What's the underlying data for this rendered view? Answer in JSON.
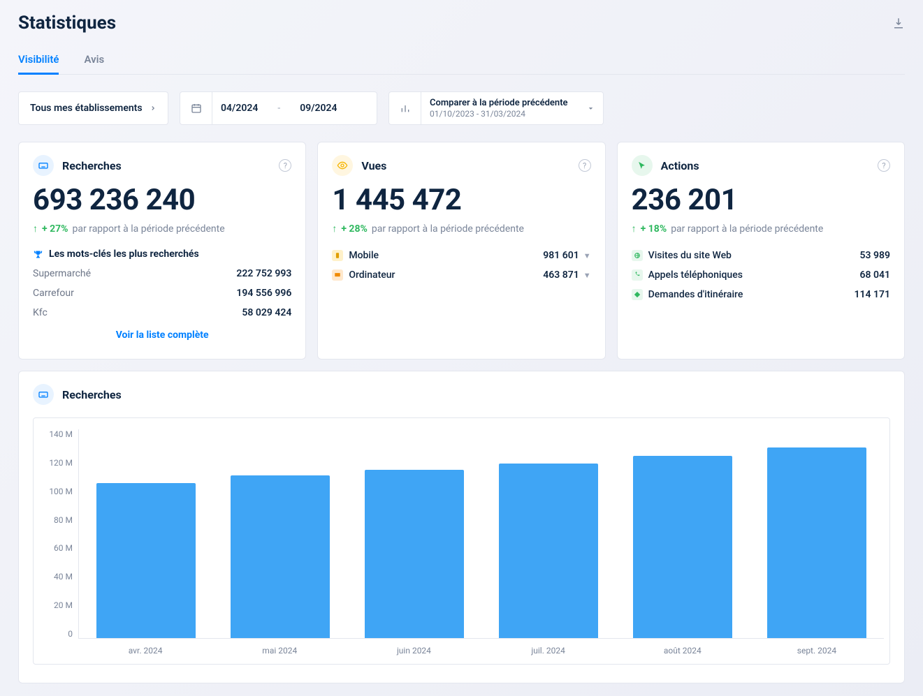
{
  "page_title": "Statistiques",
  "tabs": {
    "visibility": "Visibilité",
    "reviews": "Avis"
  },
  "filters": {
    "establishments": "Tous mes établissements",
    "date_from": "04/2024",
    "date_sep": "-",
    "date_to": "09/2024",
    "compare_title": "Comparer à la période précédente",
    "compare_sub": "01/10/2023 - 31/03/2024"
  },
  "cards": {
    "searches": {
      "title": "Recherches",
      "value": "693 236 240",
      "trend_pct": "+ 27%",
      "trend_text": "par rapport à la période précédente",
      "sub_title": "Les mots-clés les plus recherchés",
      "rows": [
        {
          "label": "Supermarché",
          "value": "222 752 993"
        },
        {
          "label": "Carrefour",
          "value": "194 556 996"
        },
        {
          "label": "Kfc",
          "value": "58 029 424"
        }
      ],
      "more_link": "Voir la liste complète"
    },
    "views": {
      "title": "Vues",
      "value": "1 445 472",
      "trend_pct": "+ 28%",
      "trend_text": "par rapport à la période précédente",
      "rows": [
        {
          "label": "Mobile",
          "value": "981 601"
        },
        {
          "label": "Ordinateur",
          "value": "463 871"
        }
      ]
    },
    "actions": {
      "title": "Actions",
      "value": "236 201",
      "trend_pct": "+ 18%",
      "trend_text": "par rapport à la période précédente",
      "rows": [
        {
          "label": "Visites du site Web",
          "value": "53 989"
        },
        {
          "label": "Appels téléphoniques",
          "value": "68 041"
        },
        {
          "label": "Demandes d'itinéraire",
          "value": "114 171"
        }
      ]
    }
  },
  "chart_section": {
    "title": "Recherches"
  },
  "chart_data": {
    "type": "bar",
    "title": "Recherches",
    "xlabel": "",
    "ylabel": "",
    "ylim": [
      0,
      140
    ],
    "y_ticks": [
      "140 M",
      "120 M",
      "100 M",
      "80 M",
      "60 M",
      "40 M",
      "20 M",
      "0"
    ],
    "categories": [
      "avr. 2024",
      "mai 2024",
      "juin 2024",
      "juil. 2024",
      "août 2024",
      "sept. 2024"
    ],
    "values": [
      104,
      109,
      113,
      117,
      122,
      128
    ],
    "unit": "M",
    "color": "#3fa5f5"
  }
}
